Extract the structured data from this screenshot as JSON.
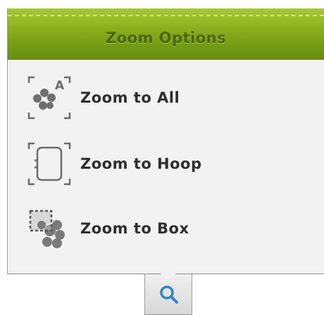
{
  "menu": {
    "title": "Zoom Options",
    "items": [
      {
        "label": "Zoom to All",
        "icon": "zoom-to-all-icon"
      },
      {
        "label": "Zoom to Hoop",
        "icon": "zoom-to-hoop-icon"
      },
      {
        "label": "Zoom to Box",
        "icon": "zoom-to-box-icon"
      }
    ]
  },
  "toolbar": {
    "zoom_tab_icon": "magnifier-icon"
  },
  "colors": {
    "header_green": "#8db21f",
    "header_text": "#4a6411",
    "panel_bg": "#f2f2f2",
    "label_text": "#2e2e2e",
    "icon_gray": "#6e6e6e",
    "magnifier_blue": "#2f86c4"
  }
}
